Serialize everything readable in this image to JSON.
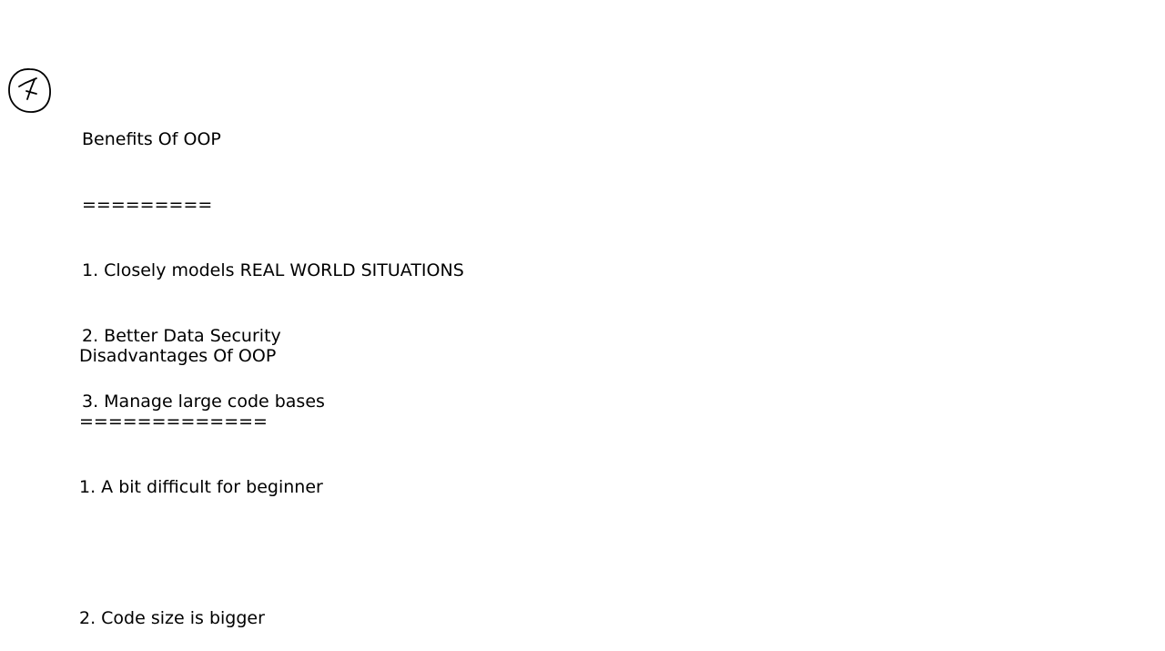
{
  "benefits": {
    "title": "Benefits Of OOP",
    "underline": "=========",
    "items": [
      "1. Closely models REAL WORLD SITUATIONS",
      "2. Better Data Security",
      "3. Manage large code bases"
    ]
  },
  "disadvantages": {
    "title": "Disadvantages Of OOP",
    "underline": "=============",
    "items": [
      "1. A bit difficult for beginner",
      "2. Code size is bigger"
    ]
  },
  "mark": {
    "icon": "circled-seven-mark-icon",
    "color": "#000000"
  }
}
